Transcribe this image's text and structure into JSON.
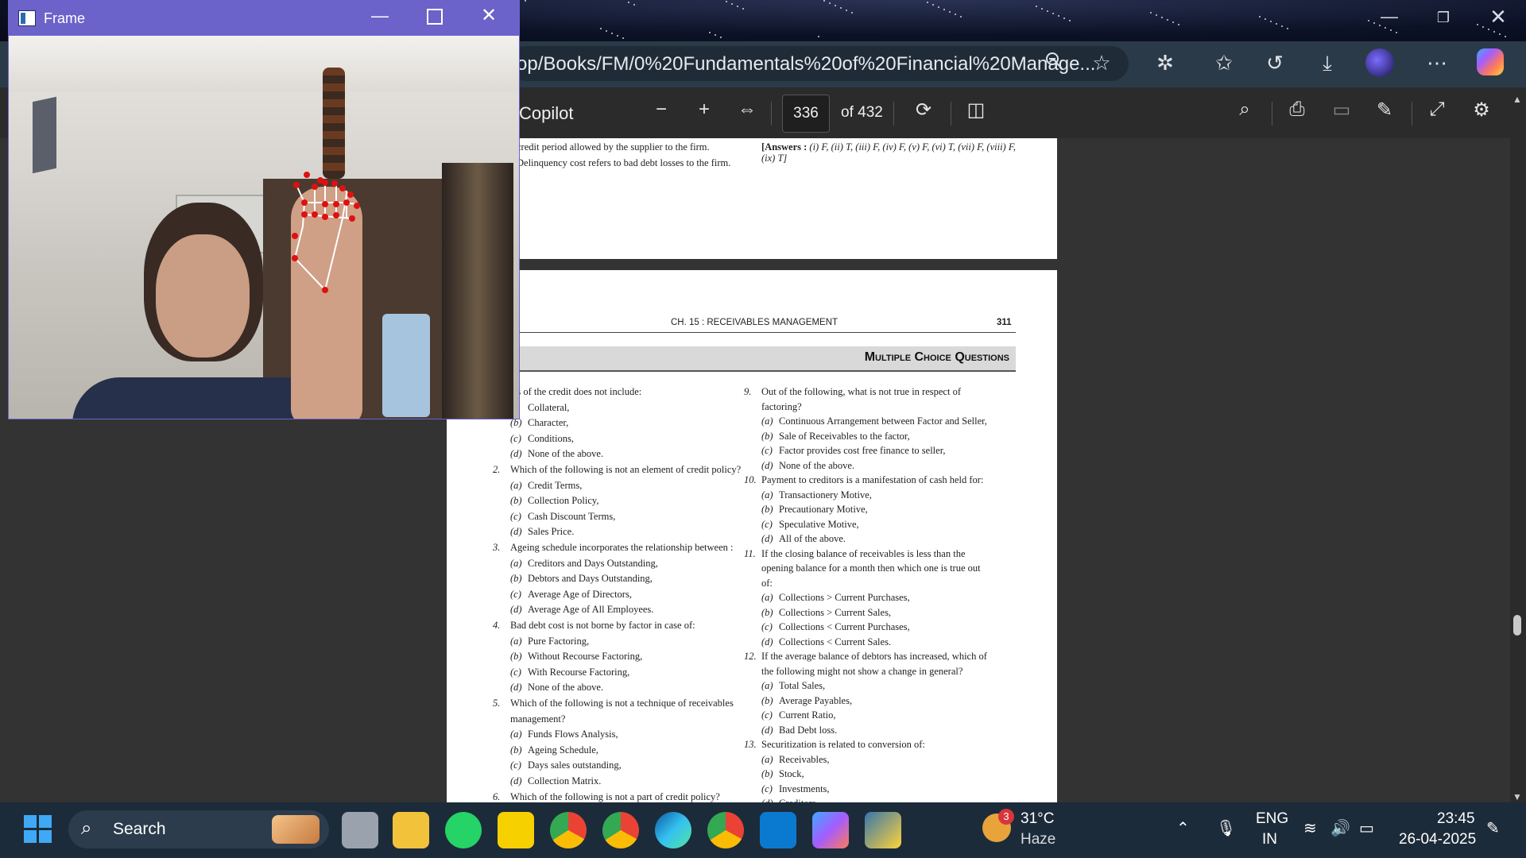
{
  "browser": {
    "address": "op/Books/FM/0%20Fundamentals%20of%20Financial%20Manage...",
    "copilot_label": "Copilot",
    "page_current": "336",
    "page_total": "of 432"
  },
  "frame_window": {
    "title": "Frame"
  },
  "pdf": {
    "page1": {
      "left_col": [
        "credit period allowed by the supplier to the firm.",
        "Delinquency cost refers to bad debt losses to the firm."
      ],
      "answers_bold": "[Answers :",
      "answers_rest": " (i) F, (ii) T, (iii) F, (iv) F, (v) F, (vi) T, (vii) F, (viii) F,",
      "answers_line2": "(ix) T]"
    },
    "page2": {
      "header_left": "CH. 15 : RECEIVABLES MANAGEMENT",
      "header_right": "311",
      "section_title": "Multiple Choice Questions",
      "left_lines": [
        {
          "t": "Cs of the credit does not include:",
          "num": ""
        },
        {
          "t": "Collateral,",
          "opt": ")"
        },
        {
          "t": "Character,",
          "opt": "(b)"
        },
        {
          "t": "Conditions,",
          "opt": "(c)"
        },
        {
          "t": "None of the above.",
          "opt": "(d)"
        },
        {
          "t": "Which of the following is not an element of credit policy?",
          "num": "2."
        },
        {
          "t": "Credit Terms,",
          "opt": "(a)"
        },
        {
          "t": "Collection Policy,",
          "opt": "(b)"
        },
        {
          "t": "Cash Discount Terms,",
          "opt": "(c)"
        },
        {
          "t": "Sales Price.",
          "opt": "(d)"
        },
        {
          "t": "Ageing schedule incorporates the relationship between :",
          "num": "3."
        },
        {
          "t": "Creditors and Days Outstanding,",
          "opt": "(a)"
        },
        {
          "t": "Debtors and Days Outstanding,",
          "opt": "(b)"
        },
        {
          "t": "Average Age of Directors,",
          "opt": "(c)"
        },
        {
          "t": "Average Age of All Employees.",
          "opt": "(d)"
        },
        {
          "t": "Bad debt cost is not borne by factor in case of:",
          "num": "4."
        },
        {
          "t": "Pure Factoring,",
          "opt": "(a)"
        },
        {
          "t": "Without Recourse Factoring,",
          "opt": "(b)"
        },
        {
          "t": "With Recourse Factoring,",
          "opt": "(c)"
        },
        {
          "t": "None of the above.",
          "opt": "(d)"
        },
        {
          "t": "Which of the following is not a technique of receivables",
          "num": "5."
        },
        {
          "t": "management?",
          "num": ""
        },
        {
          "t": "Funds Flows Analysis,",
          "opt": "(a)"
        },
        {
          "t": "Ageing Schedule,",
          "opt": "(b)"
        },
        {
          "t": "Days sales outstanding,",
          "opt": "(c)"
        },
        {
          "t": "Collection Matrix.",
          "opt": "(d)"
        },
        {
          "t": "Which of the following is not a part of credit policy?",
          "num": "6."
        }
      ],
      "right_lines": [
        {
          "t": "Out of the following, what is not true in respect of",
          "num": "9."
        },
        {
          "t": "factoring?",
          "num": ""
        },
        {
          "t": "Continuous Arrangement between Factor and Seller,",
          "opt": "(a)"
        },
        {
          "t": "Sale of Receivables to the factor,",
          "opt": "(b)"
        },
        {
          "t": "Factor provides cost free finance to seller,",
          "opt": "(c)"
        },
        {
          "t": "None of the above.",
          "opt": "(d)"
        },
        {
          "t": "Payment to creditors is a manifestation of cash held for:",
          "num": "10."
        },
        {
          "t": "Transactionery Motive,",
          "opt": "(a)"
        },
        {
          "t": "Precautionary Motive,",
          "opt": "(b)"
        },
        {
          "t": "Speculative Motive,",
          "opt": "(c)"
        },
        {
          "t": "All of the above.",
          "opt": "(d)"
        },
        {
          "t": "If the closing balance of receivables is less than the",
          "num": "11."
        },
        {
          "t": "opening balance for a month then which one is true out",
          "num": ""
        },
        {
          "t": "of:",
          "num": ""
        },
        {
          "t": "Collections > Current Purchases,",
          "opt": "(a)"
        },
        {
          "t": "Collections > Current Sales,",
          "opt": "(b)"
        },
        {
          "t": "Collections < Current Purchases,",
          "opt": "(c)"
        },
        {
          "t": "Collections < Current Sales.",
          "opt": "(d)"
        },
        {
          "t": "If the average balance of debtors has increased, which of",
          "num": "12."
        },
        {
          "t": "the following might not show a change in general?",
          "num": ""
        },
        {
          "t": "Total Sales,",
          "opt": "(a)"
        },
        {
          "t": "Average Payables,",
          "opt": "(b)"
        },
        {
          "t": "Current Ratio,",
          "opt": "(c)"
        },
        {
          "t": "Bad Debt loss.",
          "opt": "(d)"
        },
        {
          "t": "Securitization is related to conversion of:",
          "num": "13."
        },
        {
          "t": "Receivables,",
          "opt": "(a)"
        },
        {
          "t": "Stock,",
          "opt": "(b)"
        },
        {
          "t": "Investments,",
          "opt": "(c)"
        },
        {
          "t": "Creditors",
          "opt": "(d)"
        }
      ]
    }
  },
  "taskbar": {
    "search_placeholder": "Search",
    "weather_temp": "31°C",
    "weather_desc": "Haze",
    "weather_badge": "3",
    "lang_1": "ENG",
    "lang_2": "IN",
    "time": "23:45",
    "date": "26-04-2025"
  },
  "colors": {
    "frame_title": "#6b63c9",
    "edge_toolbar": "#2b3a48",
    "pdf_toolbar": "#2b2b2b",
    "taskbar": "#1c2b3a"
  }
}
